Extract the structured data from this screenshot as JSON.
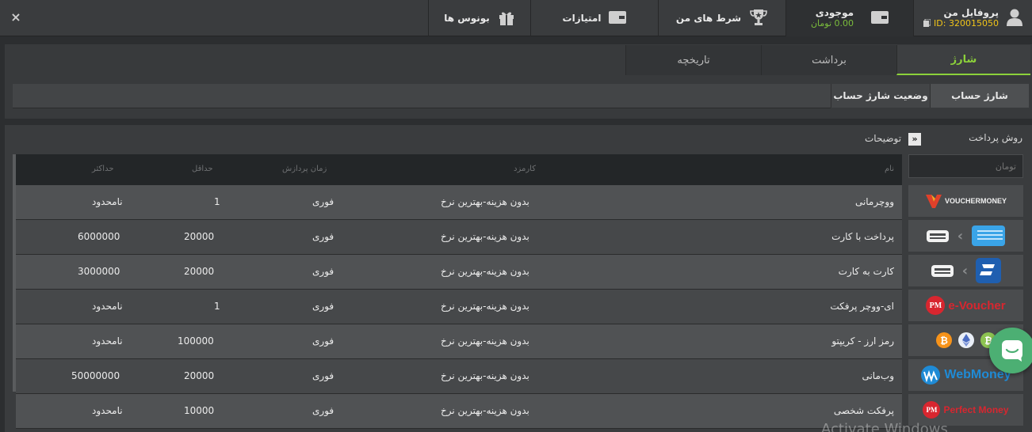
{
  "header": {
    "close_label": "×",
    "profile": {
      "label": "پروفایل من",
      "id_text": "ID: 320015050"
    },
    "balance": {
      "label": "موجودی",
      "amount": "0.00 تومان"
    },
    "tabs": [
      {
        "label": "شرط های من"
      },
      {
        "label": "امتیازات"
      },
      {
        "label": "بونوس ها"
      }
    ]
  },
  "account_tabs": [
    {
      "label": "شارژ"
    },
    {
      "label": "برداشت"
    },
    {
      "label": "تاریخچه"
    }
  ],
  "sub_tabs": [
    {
      "label": "شارژ حساب"
    },
    {
      "label": "وضعیت شارژ حساب"
    }
  ],
  "payment": {
    "methods_label": "روش پرداخت",
    "desc_toggle": "»",
    "desc_label": "توضیحات",
    "currency_placeholder": "تومان"
  },
  "table": {
    "headers": {
      "name": "نام",
      "fee": "کارمزد",
      "time": "زمان پردازش",
      "min": "حداقل",
      "max": "حداکثر"
    },
    "rows": [
      {
        "name": "ووچرمانی",
        "fee": "بدون هزینه-بهترین نرخ",
        "time": "فوری",
        "min": "1",
        "max": "نامحدود"
      },
      {
        "name": "پرداخت با کارت",
        "fee": "بدون هزینه-بهترین نرخ",
        "time": "فوری",
        "min": "20000",
        "max": "6000000"
      },
      {
        "name": "کارت به کارت",
        "fee": "بدون هزینه-بهترین نرخ",
        "time": "فوری",
        "min": "20000",
        "max": "3000000"
      },
      {
        "name": "ای-ووچر پرفکت",
        "fee": "بدون هزینه-بهترین نرخ",
        "time": "فوری",
        "min": "1",
        "max": "نامحدود"
      },
      {
        "name": "رمز ارز - کریپتو",
        "fee": "بدون هزینه-بهترین نرخ",
        "time": "فوری",
        "min": "100000",
        "max": "نامحدود"
      },
      {
        "name": "وب‌مانی",
        "fee": "بدون هزینه-بهترین نرخ",
        "time": "فوری",
        "min": "20000",
        "max": "50000000"
      },
      {
        "name": "پرفکت شخصی",
        "fee": "بدون هزینه-بهترین نرخ",
        "time": "فوری",
        "min": "10000",
        "max": "نامحدود"
      }
    ]
  },
  "logos": {
    "vouchermoney": "VOUCHERMONEY",
    "pm": "PM",
    "evoucher": "e-Voucher",
    "webmoney": "WebMoney",
    "perfectmoney": "Perfect Money"
  },
  "colors": {
    "accent_green": "#8cd13a",
    "balance_green": "#7bbd3c",
    "id_yellow": "#f0c419",
    "chat_green": "#4caf73",
    "pm_red": "#d8262f",
    "webmoney_blue": "#1f8bd6"
  },
  "watermark": "Activate Windows"
}
